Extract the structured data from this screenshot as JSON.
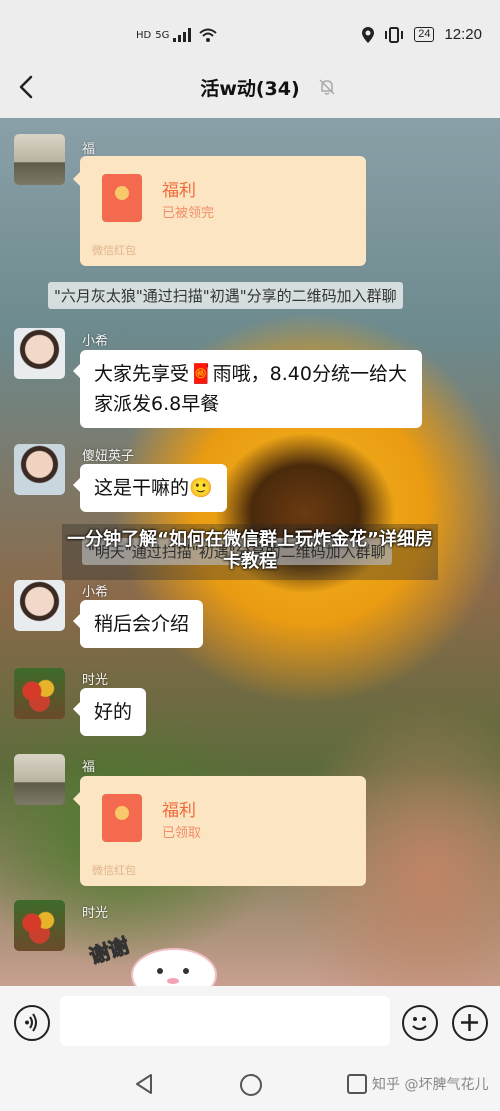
{
  "status_bar": {
    "network": "HD",
    "signal": "5G",
    "battery": "24",
    "time": "12:20"
  },
  "header": {
    "title": "活w动(34)"
  },
  "messages": [
    {
      "sender": "福",
      "type": "redpacket",
      "title": "福利",
      "status": "已被领完",
      "footer": "微信红包"
    },
    {
      "type": "system",
      "text": "\"六月灰太狼\"通过扫描\"初遇\"分享的二维码加入群聊"
    },
    {
      "sender": "小希",
      "type": "text",
      "text": "大家先享受🧧雨哦，8.40分统一给大家派发6.8早餐"
    },
    {
      "sender": "傻妞英子",
      "type": "text",
      "text": "这是干嘛的🙂"
    },
    {
      "type": "system",
      "text": "\"明天\"通过扫描\"初遇\"分享的二维码加入群聊"
    },
    {
      "sender": "小希",
      "type": "text",
      "text": "稍后会介绍"
    },
    {
      "sender": "时光",
      "type": "text",
      "text": "好的"
    },
    {
      "sender": "福",
      "type": "redpacket",
      "title": "福利",
      "status": "已领取",
      "footer": "微信红包"
    },
    {
      "sender": "时光",
      "type": "sticker",
      "text": "谢谢"
    }
  ],
  "overlay": {
    "title": "一分钟了解“如何在微信群上玩炸金花”详细房卡教程"
  },
  "watermark": "知乎 @坏脾气花儿",
  "icons": [
    "back-icon",
    "mute-icon",
    "voice-icon",
    "emoji-icon",
    "plus-icon",
    "nav-back-icon",
    "nav-home-icon",
    "nav-recent-icon"
  ]
}
